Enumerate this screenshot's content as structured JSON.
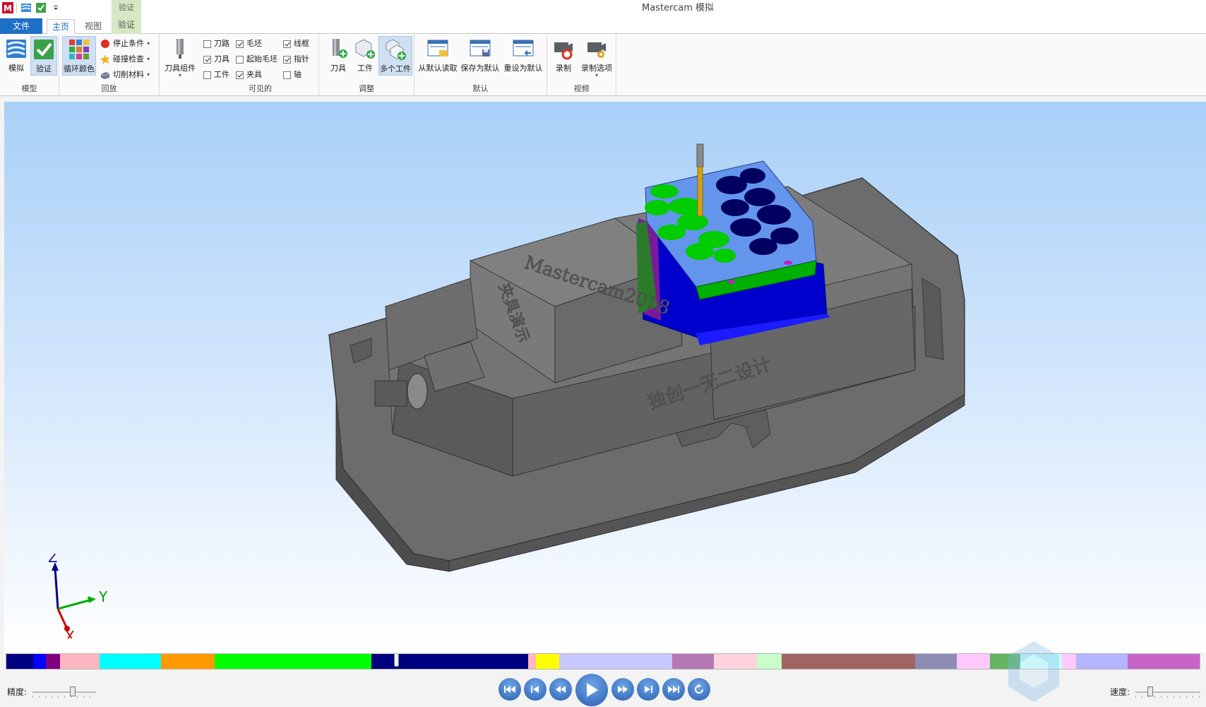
{
  "title_bar": {
    "app_title": "Mastercam 模拟",
    "context_group": "验证",
    "quick_access": [
      "mastercam-logo-icon",
      "simulate-icon",
      "verify-icon",
      "customize-dropdown-icon"
    ]
  },
  "tabs": {
    "file": "文件",
    "home": "主页",
    "view": "视图",
    "verify": "验证",
    "active": "主页"
  },
  "ribbon": {
    "model": {
      "label": "模型",
      "simulate": "模拟",
      "verify": "验证"
    },
    "playback": {
      "label": "回放",
      "cycle_colors": "循环颜色",
      "stop_conditions": "停止条件",
      "collision_check": "碰撞检查",
      "cut_stock": "切削材料"
    },
    "tool_assembly": "刀具组件",
    "visible": {
      "label": "可见的",
      "items": [
        {
          "label": "刀路",
          "checked": false
        },
        {
          "label": "刀具",
          "checked": true
        },
        {
          "label": "工件",
          "checked": false
        },
        {
          "label": "毛坯",
          "checked": true
        },
        {
          "label": "起始毛坯",
          "checked": false
        },
        {
          "label": "夹具",
          "checked": true
        },
        {
          "label": "线框",
          "checked": true
        },
        {
          "label": "指针",
          "checked": true
        },
        {
          "label": "轴",
          "checked": false
        }
      ]
    },
    "adjust": {
      "label": "调整",
      "tool": "刀具",
      "workpiece": "工件",
      "multi_workpiece": "多个工件"
    },
    "defaults": {
      "label": "默认",
      "load_default": "从默认读取",
      "save_default": "保存为默认",
      "reset_default": "重设为默认"
    },
    "video": {
      "label": "视频",
      "record": "录制",
      "record_options": "录制选项"
    }
  },
  "viewport": {
    "fixture_text_arc": "Mastercam2018",
    "fixture_text_cn": "夹具演示",
    "base_text": "独创一无二设计",
    "axes": {
      "x": "X",
      "y": "Y",
      "z": "Z"
    }
  },
  "timeline": {
    "playhead_position": 0.325,
    "segment_colors": [
      "#000080",
      "#0000ff",
      "#800080",
      "#ffb6c1",
      "#00ffff",
      "#ff9900",
      "#00ff00",
      "#000080",
      "#ffb6c1",
      "#ffff00",
      "#c8c8ff",
      "#b478b4",
      "#ffd2dc",
      "#c8ffc8",
      "#a06464",
      "#8c8cb4",
      "#ffc8ff",
      "#64b464",
      "#c8ffff",
      "#ffc8ff",
      "#b4b4ff",
      "#c864c8"
    ]
  },
  "controls": {
    "precision_label": "精度:",
    "speed_label": "速度:",
    "precision_value": 0.65,
    "speed_value": 0.2,
    "buttons": [
      "go-to-start",
      "step-back",
      "rewind",
      "play",
      "fast-forward",
      "step-forward",
      "go-to-end",
      "loop"
    ]
  },
  "colors": {
    "file_tab": "#1e6fc6",
    "context_tab": "#d5e8c4",
    "vise": "#6b6b6b",
    "stock_top": "#6495ed",
    "stock_side": "#0000cd",
    "pocket_green": "#00cc00",
    "pocket_navy": "#000060",
    "tool": "#d4a017"
  }
}
